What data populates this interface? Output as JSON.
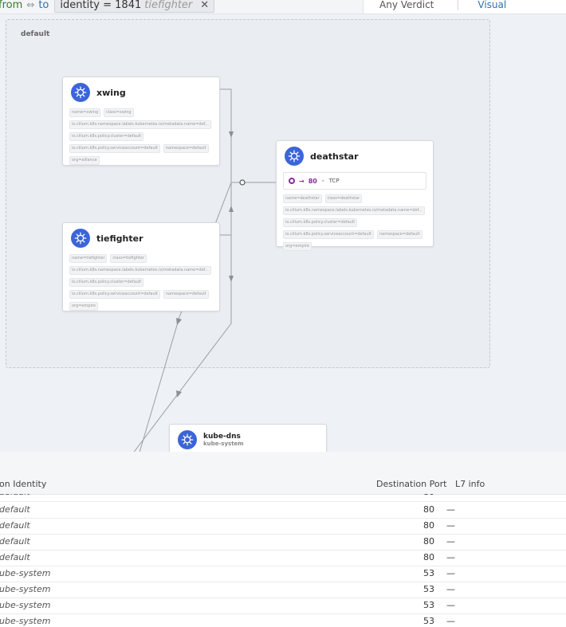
{
  "filter": {
    "direction": "from",
    "arrow": "⇔",
    "to": "to",
    "key": "identity = 1841",
    "value": "tiefighter",
    "close": "✕"
  },
  "toolbar": {
    "verdict": "Any Verdict",
    "visual": "Visual"
  },
  "namespace": {
    "label": "default"
  },
  "services": {
    "xwing": {
      "title": "xwing",
      "labels": [
        "name=xwing",
        "class=xwing",
        "io.cilium.k8s.namespace.labels.kubernetes.io/metadata.name=def...",
        "io.cilium.k8s.policy.cluster=default",
        "io.cilium.k8s.policy.serviceaccount=default",
        "namespace=default",
        "org=alliance"
      ]
    },
    "tiefighter": {
      "title": "tiefighter",
      "labels": [
        "name=tiefighter",
        "class=tiefighter",
        "io.cilium.k8s.namespace.labels.kubernetes.io/metadata.name=def...",
        "io.cilium.k8s.policy.cluster=default",
        "io.cilium.k8s.policy.serviceaccount=default",
        "namespace=default",
        "org=empire"
      ]
    },
    "deathstar": {
      "title": "deathstar",
      "port": "80",
      "arrow": "→",
      "dot": "•",
      "protocol": "TCP",
      "labels": [
        "name=deathstar",
        "class=deathstar",
        "io.cilium.k8s.namespace.labels.kubernetes.io/metadata.name=def...",
        "io.cilium.k8s.policy.cluster=default",
        "io.cilium.k8s.policy.serviceaccount=default",
        "namespace=default",
        "org=empire"
      ]
    },
    "kubedns": {
      "title": "kube-dns",
      "namespace": "kube-system"
    }
  },
  "table": {
    "headers": {
      "destination_identity": "on Identity",
      "destination_port": "Destination Port",
      "l7": "L7 info"
    },
    "rows": [
      {
        "src": "default",
        "port": "80",
        "l7": "—"
      },
      {
        "src": "default",
        "port": "80",
        "l7": "—"
      },
      {
        "src": "default",
        "port": "80",
        "l7": "—"
      },
      {
        "src": "default",
        "port": "80",
        "l7": "—"
      },
      {
        "src": "default",
        "port": "80",
        "l7": "—"
      },
      {
        "src": "ube-system",
        "port": "53",
        "l7": "—"
      },
      {
        "src": "ube-system",
        "port": "53",
        "l7": "—"
      },
      {
        "src": "ube-system",
        "port": "53",
        "l7": "—"
      },
      {
        "src": "ube-system",
        "port": "53",
        "l7": "—"
      }
    ]
  },
  "colors": {
    "k8s_blue": "#3b65d8",
    "port_purple": "#8a2b9c",
    "link_blue": "#2f6fb4",
    "from_green": "#3a7c2a"
  }
}
